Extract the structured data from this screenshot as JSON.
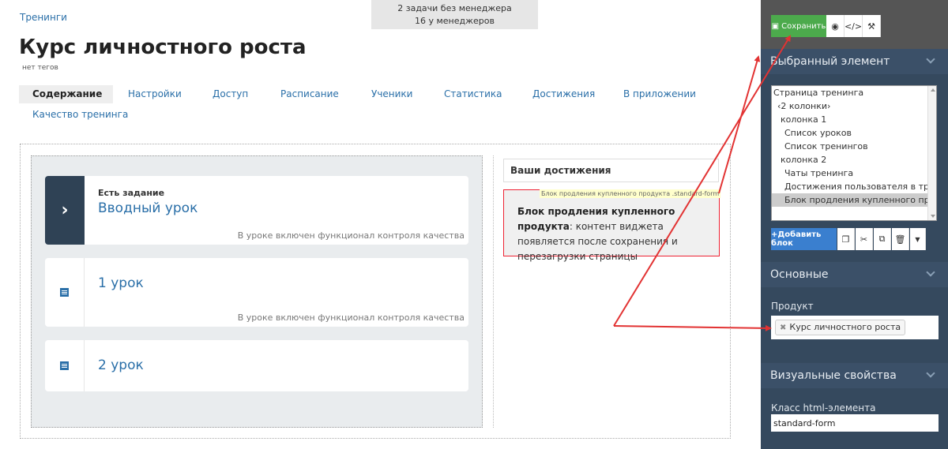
{
  "breadcrumb": "Тренинги",
  "notice": {
    "line1": "2 задачи без менеджера",
    "line2": "16 у менеджеров"
  },
  "title": "Курс личностного роста",
  "tags": "нет тегов",
  "tabs": [
    "Содержание",
    "Настройки",
    "Доступ",
    "Расписание",
    "Ученики",
    "Статистика",
    "Достижения",
    "В приложении",
    "Качество тренинга"
  ],
  "lessons": [
    {
      "task": "Есть задание",
      "name": "Вводный урок",
      "note": "В уроке включен функционал контроля качества",
      "icon": "chevron-right-icon"
    },
    {
      "task": "",
      "name": "1 урок",
      "note": "В уроке включен функционал контроля качества",
      "icon": "document-list-icon"
    },
    {
      "task": "",
      "name": "2 урок",
      "note": "",
      "icon": "document-list-icon"
    }
  ],
  "achievements": {
    "title": "Ваши достижения",
    "tag": "Блок продления купленного продукта .standard-form",
    "text_bold": "Блок продления купленного продукта",
    "text_rest": ": контент виджета появляется после сохранения и перезагрузки страницы"
  },
  "panel": {
    "save": "Сохранить",
    "selected_section": "Выбранный элемент",
    "tree": [
      "Страница тренинга",
      "‹2 колонки›",
      "колонка 1",
      "Список уроков",
      "Список тренингов",
      "колонка 2",
      "Чаты тренинга",
      "Достижения пользователя в тре",
      "Блок продления купленного про"
    ],
    "add_block": "+Добавить блок",
    "main_section": "Основные",
    "product_label": "Продукт",
    "product_value": "Курс личностного роста",
    "visual_section": "Визуальные свойства",
    "class_label": "Класс html-элемента",
    "class_value": "standard-form"
  },
  "colors": {
    "accent": "#2a6fa8",
    "panel": "#35495e",
    "save": "#4caa4c",
    "add": "#3a7fcf",
    "highlight": "#e23333"
  }
}
